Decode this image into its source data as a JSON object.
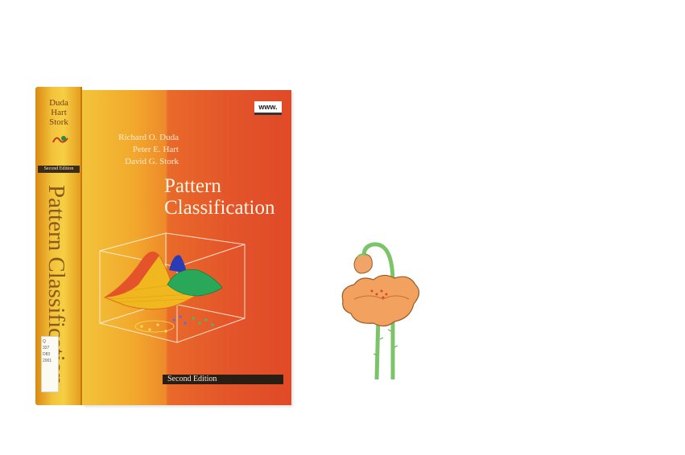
{
  "book": {
    "spine": {
      "authors": [
        "Duda",
        "Hart",
        "Stork"
      ],
      "edition": "Second Edition",
      "title": "Pattern Classification",
      "label_lines": [
        "Q",
        "327",
        "D83",
        "2001"
      ]
    },
    "cover": {
      "badge": "www.",
      "authors": [
        "Richard O. Duda",
        "Peter E. Hart",
        "David G. Stork"
      ],
      "title_lines": [
        "Pattern",
        "Classification"
      ],
      "edition": "Second Edition"
    }
  },
  "colors": {
    "cover_orange": "#e4552a",
    "cover_yellow": "#f3c43a",
    "spine_gold": "#f2c23a",
    "poppy_petal": "#f2a15e",
    "stem_green": "#7cc46a"
  }
}
